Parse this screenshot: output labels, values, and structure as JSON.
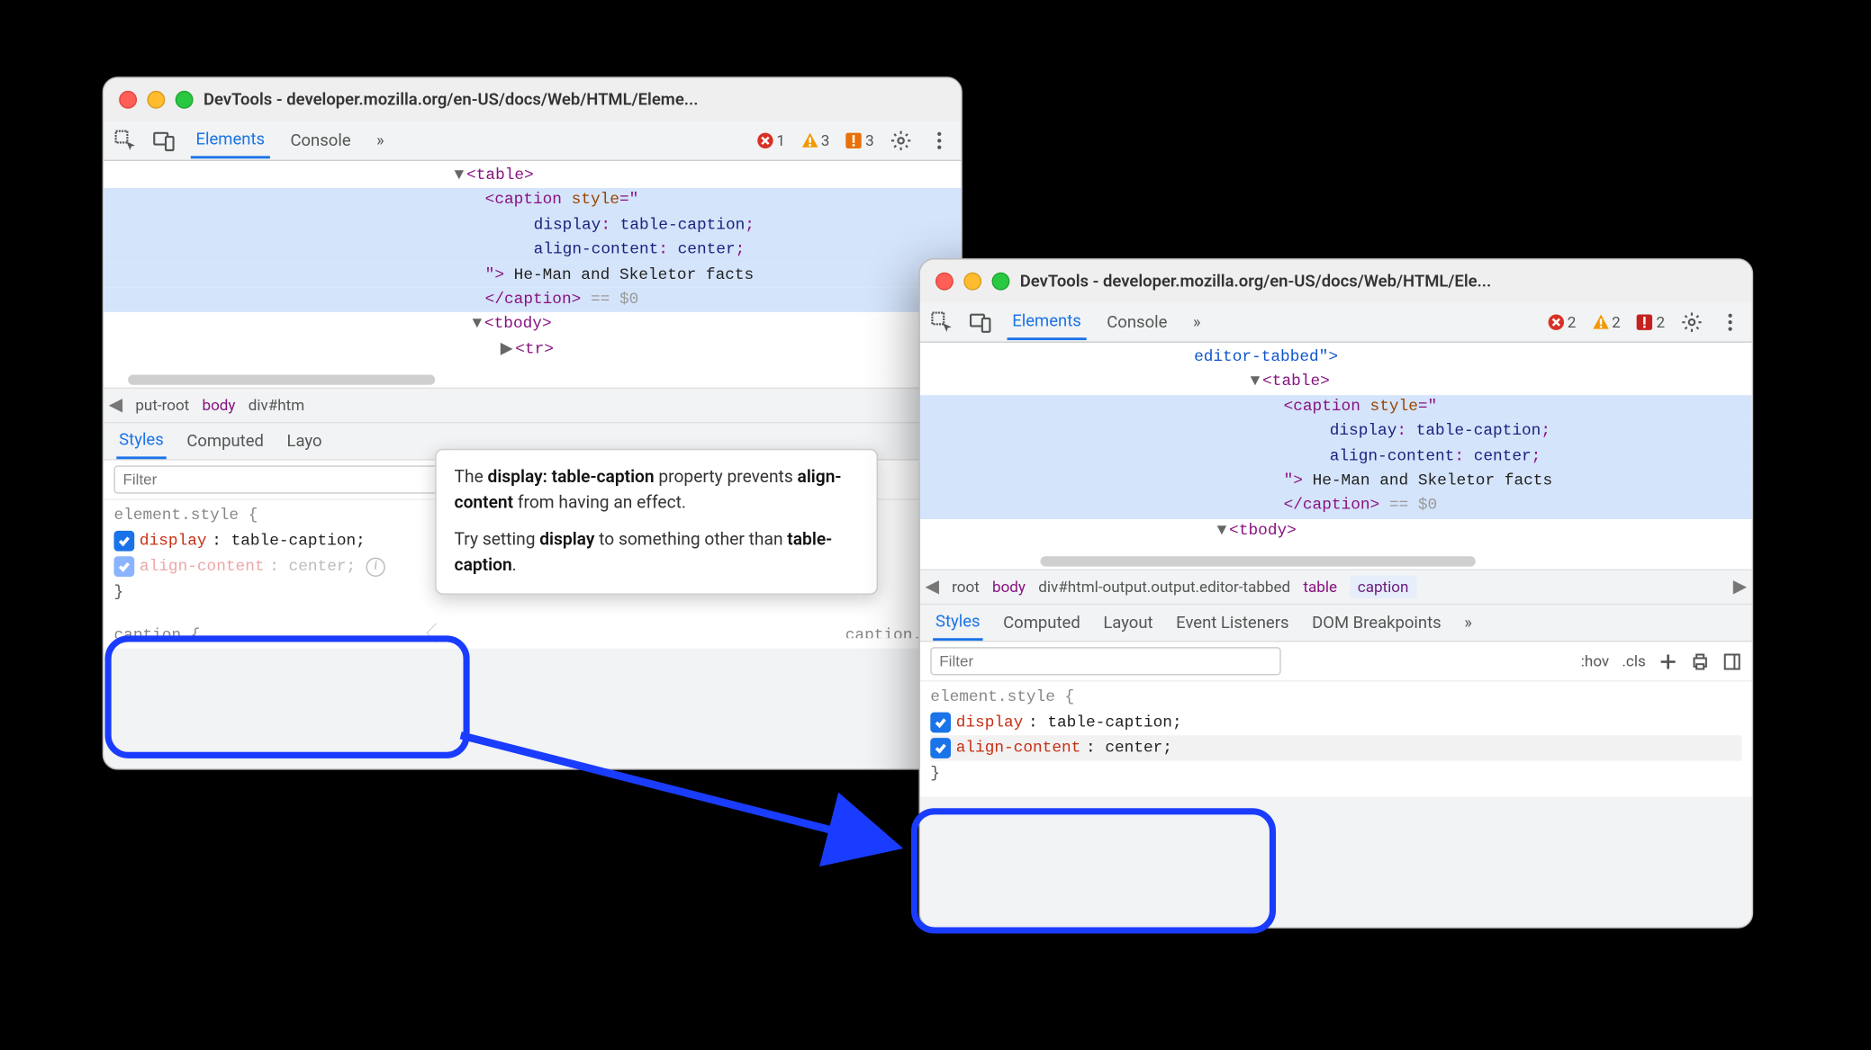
{
  "winA": {
    "title": "DevTools - developer.mozilla.org/en-US/docs/Web/HTML/Eleme...",
    "tabs": {
      "elements": "Elements",
      "console": "Console",
      "more": "»"
    },
    "status": {
      "errors": "1",
      "warnings": "3",
      "flags": "3"
    },
    "dom": {
      "l1": "<table>",
      "l2a": "<caption",
      "l2b": "style",
      "l2c": "=\"",
      "l3a": "display",
      "l3b": ": ",
      "l3c": "table-caption",
      "l3d": ";",
      "l4a": "align-content",
      "l4b": ": ",
      "l4c": "center",
      "l4d": ";",
      "l5a": "\">",
      "l5b": " He-Man and Skeletor facts",
      "l6a": "</caption>",
      "l6b": " == $0",
      "l7": "<tbody>",
      "l8": "<tr>"
    },
    "crumbs": {
      "a0": "◀",
      "a1": "put-root",
      "a2": "body",
      "a3": "div#htm",
      "aEnd": "▶"
    },
    "subtabs": {
      "styles": "Styles",
      "computed": "Computed",
      "layout": "Layo"
    },
    "filter_ph": "Filter",
    "rule": {
      "head": "element.style {",
      "d1p": "display",
      "d1v": ": table-caption;",
      "d2p": "align-content",
      "d2v": ": center;",
      "close": "}"
    },
    "cutoffL": "caption {",
    "cutoffR": "caption.htm"
  },
  "tooltip": {
    "p1a": "The ",
    "p1b": "display: table-caption",
    "p1c": " property prevents ",
    "p1d": "align-content",
    "p1e": " from having an effect.",
    "p2a": "Try setting ",
    "p2b": "display",
    "p2c": " to something other than ",
    "p2d": "table-caption",
    "p2e": "."
  },
  "winB": {
    "title": "DevTools - developer.mozilla.org/en-US/docs/Web/HTML/Ele...",
    "tabs": {
      "elements": "Elements",
      "console": "Console",
      "more": "»"
    },
    "status": {
      "errors": "2",
      "warnings": "2",
      "flags": "2"
    },
    "dom": {
      "l0": "editor-tabbed\">",
      "l1": "<table>",
      "l2a": "<caption",
      "l2b": "style",
      "l2c": "=\"",
      "l3a": "display",
      "l3b": ": ",
      "l3c": "table-caption",
      "l3d": ";",
      "l4a": "align-content",
      "l4b": ": ",
      "l4c": "center",
      "l4d": ";",
      "l5a": "\">",
      "l5b": " He-Man and Skeletor facts",
      "l6a": "</caption>",
      "l6b": " == $0",
      "l7": "<tbody>"
    },
    "crumbs": {
      "a0": "◀",
      "a1": "root",
      "a2": "body",
      "a3": "div#html-output.output.editor-tabbed",
      "a4": "table",
      "a5": "caption",
      "aEnd": "▶"
    },
    "subtabs": {
      "styles": "Styles",
      "computed": "Computed",
      "layout": "Layout",
      "evt": "Event Listeners",
      "dom": "DOM Breakpoints",
      "more": "»"
    },
    "filter_ph": "Filter",
    "tools": {
      "hov": ":hov",
      "cls": ".cls"
    },
    "rule": {
      "head": "element.style {",
      "d1p": "display",
      "d1v": ": table-caption;",
      "d2p": "align-content",
      "d2v": ": center;",
      "close": "}"
    }
  }
}
